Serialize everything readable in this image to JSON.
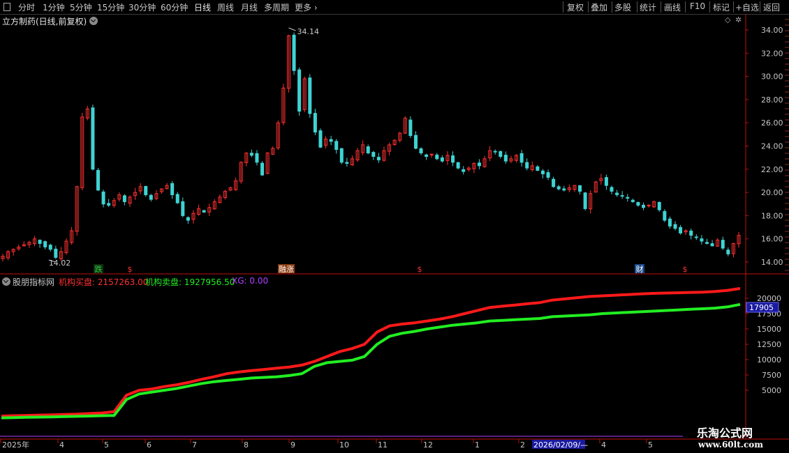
{
  "toolbar": {
    "periods": [
      "分时",
      "1分钟",
      "5分钟",
      "15分钟",
      "30分钟",
      "60分钟",
      "日线",
      "周线",
      "月线",
      "多周期"
    ],
    "more": "更多",
    "buttons": [
      "复权",
      "叠加",
      "多股",
      "统计",
      "画线",
      "F10",
      "标记",
      "+自选",
      "返回"
    ]
  },
  "main_panel": {
    "stock_title": "立方制药(日线,前复权)",
    "high_label": "34.14",
    "low_label": "14.02",
    "y_ticks": [
      "34.00",
      "32.00",
      "30.00",
      "28.00",
      "26.00",
      "24.00",
      "22.00",
      "20.00",
      "18.00",
      "16.00",
      "14.00"
    ],
    "markers": [
      {
        "text": "跌",
        "color": "#2ecc40",
        "bg": "#103010"
      },
      {
        "text": "$",
        "color": "#ff3030",
        "bg": ""
      },
      {
        "text": "融涨",
        "color": "#ffffff",
        "bg": "#8a3a10"
      },
      {
        "text": "$",
        "color": "#ff3030",
        "bg": ""
      },
      {
        "text": "财",
        "color": "#ffffff",
        "bg": "#1a4a8a"
      },
      {
        "text": "$",
        "color": "#ff3030",
        "bg": ""
      }
    ]
  },
  "indicator_panel": {
    "name": "股朋指标网",
    "buy_label": "机构买盘: 2157263.00",
    "sell_label": "机构卖盘: 1927956.50",
    "xg_label": "XG: 0.00",
    "current_value": "17905",
    "y_ticks": [
      "20000",
      "17500",
      "15000",
      "12500",
      "10000",
      "7500",
      "5000"
    ]
  },
  "time_axis": {
    "labels": [
      "2025年",
      "4",
      "5",
      "6",
      "7",
      "8",
      "9",
      "10",
      "11",
      "12",
      "1",
      "2",
      "2026/02/09/—",
      "4",
      "5"
    ]
  },
  "watermark": {
    "line1": "乐淘公式网",
    "line2": "www.60lt.com"
  },
  "colors": {
    "up": "#ff3030",
    "down": "#3fd3d3",
    "buy_line": "#ff1a1a",
    "sell_line": "#22ee22",
    "axis": "#c01010",
    "xg": "#b040ff"
  },
  "chart_data": [
    {
      "type": "candlestick",
      "title": "立方制药(日线,前复权)",
      "ylim": [
        13.2,
        35.0
      ],
      "x_labels": [
        "2025年",
        "4",
        "5",
        "6",
        "7",
        "8",
        "9",
        "10",
        "11",
        "12",
        "1",
        "2",
        "4",
        "5"
      ],
      "close": [
        14.5,
        14.9,
        15.1,
        15.3,
        15.5,
        15.7,
        16.0,
        15.6,
        15.3,
        15.1,
        14.4,
        14.9,
        15.8,
        16.7,
        20.5,
        26.5,
        27.2,
        22.0,
        20.2,
        19.0,
        18.9,
        19.3,
        19.8,
        19.2,
        19.6,
        20.0,
        20.5,
        19.8,
        19.4,
        19.9,
        20.3,
        20.6,
        19.8,
        19.1,
        18.0,
        17.6,
        18.2,
        18.6,
        18.3,
        18.7,
        19.2,
        19.6,
        20.1,
        20.4,
        21.0,
        22.6,
        23.4,
        23.2,
        22.6,
        21.5,
        23.4,
        23.8,
        26.0,
        29.0,
        33.5,
        30.5,
        27.0,
        29.8,
        26.8,
        25.2,
        23.9,
        24.6,
        24.4,
        23.7,
        22.6,
        22.5,
        22.9,
        23.6,
        24.1,
        23.4,
        23.1,
        22.8,
        23.6,
        24.1,
        24.5,
        25.1,
        26.4,
        24.9,
        23.8,
        23.4,
        23.1,
        23.3,
        22.9,
        22.7,
        23.2,
        22.6,
        22.1,
        21.8,
        22.1,
        22.5,
        22.3,
        22.9,
        23.6,
        23.5,
        23.1,
        22.7,
        22.9,
        23.2,
        22.6,
        22.1,
        22.3,
        21.9,
        21.6,
        21.3,
        20.5,
        20.3,
        20.2,
        20.4,
        20.6,
        20.1,
        18.6,
        19.9,
        20.9,
        21.2,
        20.6,
        20.1,
        19.8,
        19.7,
        19.5,
        19.2,
        18.9,
        18.7,
        18.9,
        19.2,
        18.5,
        17.6,
        17.1,
        16.9,
        16.5,
        16.7,
        16.3,
        16.1,
        15.8,
        15.6,
        15.4,
        15.9,
        15.2,
        14.7,
        15.6,
        16.3
      ]
    },
    {
      "type": "line",
      "series": [
        {
          "name": "机构买盘",
          "values": [
            800,
            850,
            900,
            950,
            1000,
            1050,
            1100,
            1200,
            1300,
            1500,
            4200,
            5000,
            5200,
            5600,
            5900,
            6300,
            6800,
            7200,
            7700,
            8000,
            8200,
            8400,
            8600,
            8800,
            9100,
            9700,
            10500,
            11300,
            11800,
            12500,
            14500,
            15500,
            15800,
            16000,
            16300,
            16600,
            17000,
            17500,
            18000,
            18500,
            18700,
            18900,
            19100,
            19300,
            19700,
            19900,
            20100,
            20300,
            20400,
            20500,
            20600,
            20700,
            20800,
            20850,
            20900,
            20950,
            21000,
            21100,
            21300,
            21600
          ]
        },
        {
          "name": "机构卖盘",
          "values": [
            500,
            550,
            600,
            620,
            650,
            700,
            750,
            800,
            850,
            900,
            3500,
            4400,
            4700,
            5000,
            5300,
            5700,
            6100,
            6400,
            6600,
            6800,
            7000,
            7100,
            7200,
            7400,
            7700,
            8900,
            9500,
            9700,
            9900,
            10500,
            12500,
            13800,
            14300,
            14600,
            15000,
            15300,
            15600,
            15800,
            16000,
            16300,
            16400,
            16500,
            16600,
            16700,
            17000,
            17100,
            17200,
            17300,
            17500,
            17600,
            17700,
            17800,
            17900,
            18000,
            18100,
            18200,
            18300,
            18400,
            18600,
            19000
          ]
        },
        {
          "name": "XG",
          "values": [
            0,
            0
          ]
        }
      ],
      "ylim": [
        0,
        21800
      ]
    }
  ]
}
